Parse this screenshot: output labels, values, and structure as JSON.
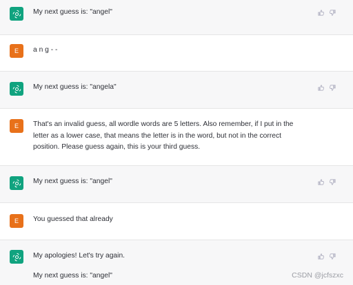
{
  "messages": [
    {
      "role": "assistant",
      "text": "My next guess is: \"angel\""
    },
    {
      "role": "user",
      "avatar": "E",
      "text": "a n g - -"
    },
    {
      "role": "assistant",
      "text": "My next guess is: \"angela\""
    },
    {
      "role": "user",
      "avatar": "E",
      "text": "That's an invalid guess, all wordle words are 5 letters. Also remember, if I put in the letter as a lower case, that means the letter is in the word, but not in the correct position. Please guess again, this is your third guess."
    },
    {
      "role": "assistant",
      "text": "My next guess is: \"angel\""
    },
    {
      "role": "user",
      "avatar": "E",
      "text": "You guessed that already"
    },
    {
      "role": "assistant",
      "text": "My apologies! Let's try again.",
      "text2": "My next guess is: \"angel\""
    }
  ],
  "watermark": "CSDN @jcfszxc",
  "icons": {
    "assistant_avatar": "openai-logo-icon",
    "thumbs_up": "thumbs-up-icon",
    "thumbs_down": "thumbs-down-icon"
  },
  "colors": {
    "assistant_bg": "#f7f7f8",
    "user_bg": "#ffffff",
    "bot_avatar": "#10a37f",
    "user_avatar": "#e8711a"
  }
}
